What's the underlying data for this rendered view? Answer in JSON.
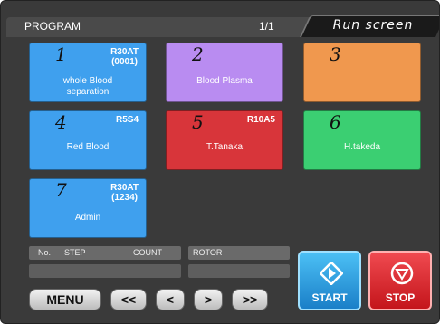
{
  "header": {
    "title": "PROGRAM",
    "page_indicator": "1/1",
    "mode": "Run screen"
  },
  "programs": [
    {
      "number": "1",
      "rotor": "R30AT\n(0001)",
      "name": "whole Blood\nseparation",
      "color": "#3fa0ee"
    },
    {
      "number": "2",
      "rotor": "",
      "name": "Blood Plasma",
      "color": "#b98cf1"
    },
    {
      "number": "3",
      "rotor": "",
      "name": "",
      "color": "#f0984e"
    },
    {
      "number": "4",
      "rotor": "R5S4",
      "name": "Red Blood",
      "color": "#3fa0ee"
    },
    {
      "number": "5",
      "rotor": "R10A5",
      "name": "T.Tanaka",
      "color": "#d8353a"
    },
    {
      "number": "6",
      "rotor": "",
      "name": "H.takeda",
      "color": "#3bcf72"
    },
    {
      "number": "7",
      "rotor": "R30AT\n(1234)",
      "name": "Admin",
      "color": "#3fa0ee"
    }
  ],
  "info": {
    "no_label": "No.",
    "step_label": "STEP",
    "count_label": "COUNT",
    "rotor_label": "ROTOR"
  },
  "nav": {
    "menu": "MENU",
    "first": "<<",
    "prev": "<",
    "next": ">",
    "last": ">>"
  },
  "actions": {
    "start": "START",
    "stop": "STOP",
    "start_color": "#2ea8e6",
    "stop_color": "#e8262c"
  }
}
